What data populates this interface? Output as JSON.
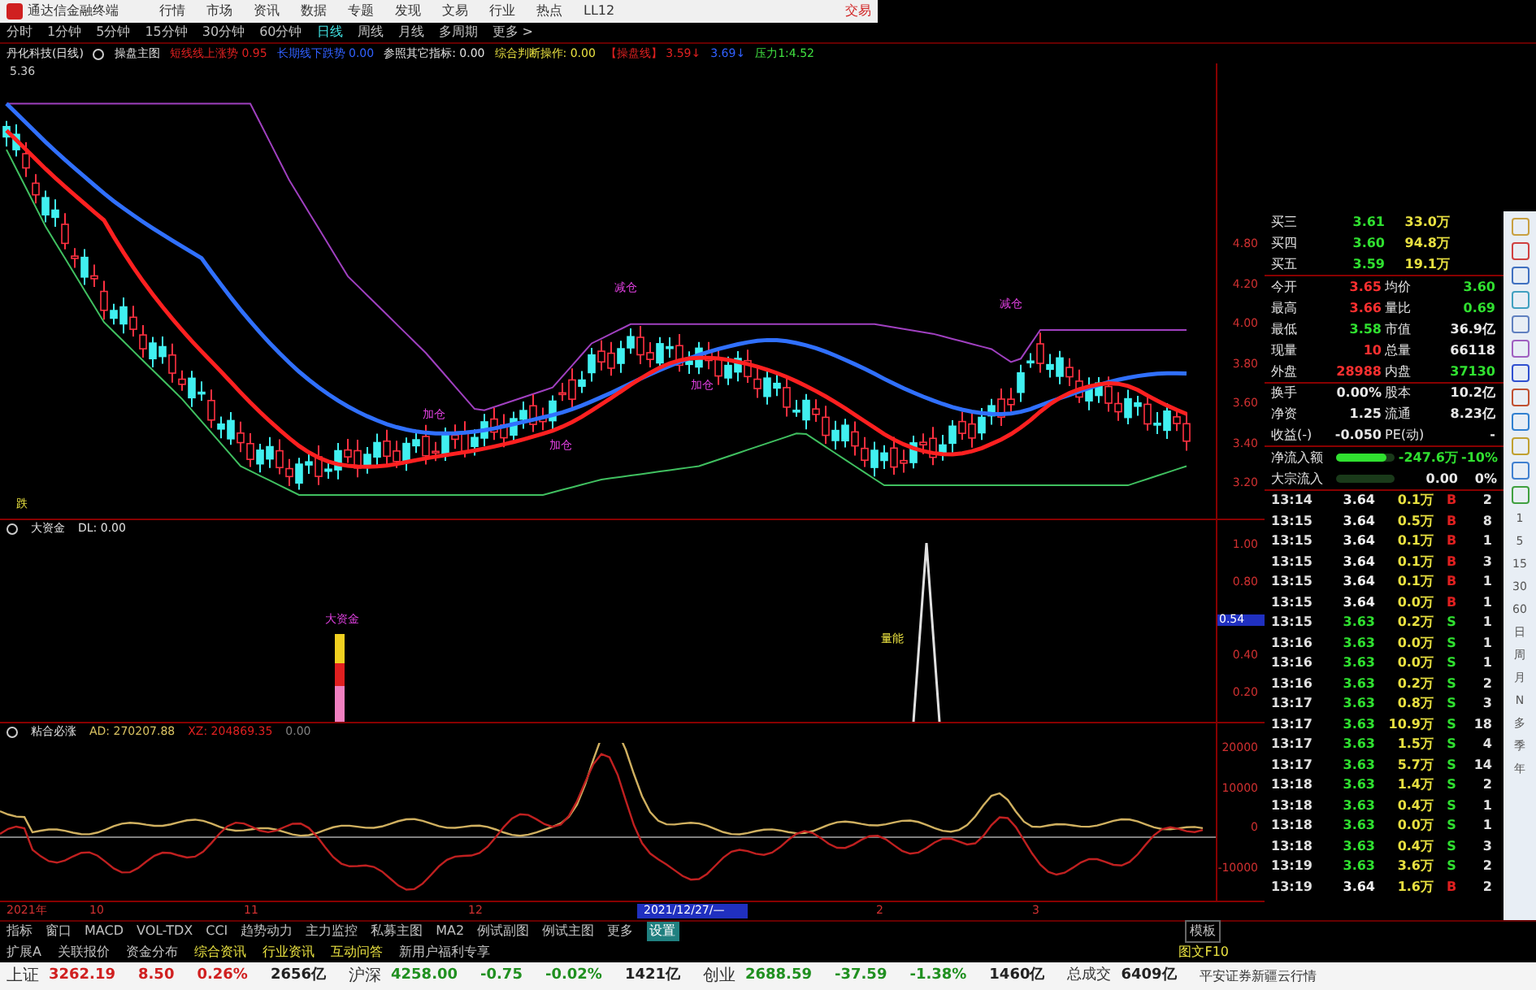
{
  "menu_bar": {
    "app_title": "通达信金融终端",
    "items": [
      "行情",
      "市场",
      "资讯",
      "数据",
      "专题",
      "发现",
      "文易",
      "行业",
      "热点",
      "LL12"
    ],
    "trade": "交易"
  },
  "periods": [
    {
      "label": "分时",
      "selected": false
    },
    {
      "label": "1分钟",
      "selected": false
    },
    {
      "label": "5分钟",
      "selected": false
    },
    {
      "label": "15分钟",
      "selected": false
    },
    {
      "label": "30分钟",
      "selected": false
    },
    {
      "label": "60分钟",
      "selected": false
    },
    {
      "label": "日线",
      "selected": true
    },
    {
      "label": "周线",
      "selected": false
    },
    {
      "label": "月线",
      "selected": false
    },
    {
      "label": "多周期",
      "selected": false
    },
    {
      "label": "更多 >",
      "selected": false
    }
  ],
  "main_chart": {
    "header": [
      {
        "text": "丹化科技(日线)",
        "color": "#e0e0e0"
      },
      {
        "text": "操盘主图",
        "color": "#e0e0e0"
      },
      {
        "text": "短线线上涨势 0.95",
        "color": "#e02020"
      },
      {
        "text": "长期线下跌势 0.00",
        "color": "#3060ff"
      },
      {
        "text": "参照其它指标: 0.00",
        "color": "#e0e0e0"
      },
      {
        "text": "综合判断操作: 0.00",
        "color": "#e8e040"
      },
      {
        "text": "【操盘线】 3.59↓",
        "color": "#e02020"
      },
      {
        "text": "3.69↓",
        "color": "#3060ff"
      },
      {
        "text": "压力1:4.52",
        "color": "#40e040"
      }
    ],
    "top_price": "5.36",
    "annotations": [
      {
        "text": "减仓",
        "color": "#e040e0"
      },
      {
        "text": "减仓",
        "color": "#e040e0"
      },
      {
        "text": "加仓",
        "color": "#e040e0"
      },
      {
        "text": "加仓",
        "color": "#e040e0"
      },
      {
        "text": "加仓",
        "color": "#e040e0"
      },
      {
        "text": "跌",
        "color": "#e8e040"
      }
    ],
    "axis": [
      "4.80",
      "4.20",
      "4.00",
      "3.80",
      "3.60",
      "3.40",
      "3.20"
    ]
  },
  "fund_chart": {
    "name": "大资金",
    "value": "DL: 0.00",
    "labels": [
      {
        "text": "大资金",
        "color": "#e040e0"
      },
      {
        "text": "量能",
        "color": "#e8e040"
      }
    ],
    "axis": [
      {
        "text": "1.00",
        "kind": "tick"
      },
      {
        "text": "0.80",
        "kind": "tick"
      },
      {
        "text": "0.54",
        "kind": "cursor"
      },
      {
        "text": "0.40",
        "kind": "tick"
      },
      {
        "text": "0.20",
        "kind": "tick"
      }
    ]
  },
  "bond_chart": {
    "name": "粘合必涨",
    "values": [
      {
        "text": "AD: 270207.88",
        "color": "#d8c060"
      },
      {
        "text": "XZ: 204869.35",
        "color": "#e02020"
      },
      {
        "text": "0.00",
        "color": "#808080"
      }
    ],
    "axis": [
      "20000",
      "10000",
      "0",
      "-10000"
    ]
  },
  "date_axis": [
    "2021年",
    "10",
    "11",
    "12",
    "2021/12/27/—",
    "2",
    "3"
  ],
  "quote": {
    "orders": [
      {
        "label": "买三",
        "price": "3.61",
        "volume": "33.0万"
      },
      {
        "label": "买四",
        "price": "3.60",
        "volume": "94.8万"
      },
      {
        "label": "买五",
        "price": "3.59",
        "volume": "19.1万"
      }
    ],
    "stats": [
      {
        "cells": [
          {
            "label": "今开",
            "value": "3.65",
            "color": "#ff3030"
          },
          {
            "label": "均价",
            "value": "3.60",
            "color": "#30e030"
          }
        ]
      },
      {
        "cells": [
          {
            "label": "最高",
            "value": "3.66",
            "color": "#ff3030"
          },
          {
            "label": "量比",
            "value": "0.69",
            "color": "#30e030"
          }
        ]
      },
      {
        "cells": [
          {
            "label": "最低",
            "value": "3.58",
            "color": "#30e030"
          },
          {
            "label": "市值",
            "value": "36.9亿",
            "color": "#e8e8e8"
          }
        ]
      },
      {
        "cells": [
          {
            "label": "现量",
            "value": "10",
            "color": "#ff3030"
          },
          {
            "label": "总量",
            "value": "66118",
            "color": "#e8e8e8"
          }
        ]
      },
      {
        "cells": [
          {
            "label": "外盘",
            "value": "28988",
            "color": "#ff3030"
          },
          {
            "label": "内盘",
            "value": "37130",
            "color": "#30e030"
          }
        ]
      },
      {
        "cells": [
          {
            "label": "换手",
            "value": "0.00%",
            "color": "#e8e8e8"
          },
          {
            "label": "股本",
            "value": "10.2亿",
            "color": "#e8e8e8"
          }
        ]
      },
      {
        "cells": [
          {
            "label": "净资",
            "value": "1.25",
            "color": "#e8e8e8"
          },
          {
            "label": "流通",
            "value": "8.23亿",
            "color": "#e8e8e8"
          }
        ]
      },
      {
        "cells": [
          {
            "label": "收益(-)",
            "value": "-0.050",
            "color": "#e8e8e8"
          },
          {
            "label": "PE(动)",
            "value": "-",
            "color": "#e8e8e8"
          }
        ]
      }
    ],
    "flows": [
      {
        "label": "净流入额",
        "level": 0.85,
        "amount": "-247.6万",
        "percent": "-10%",
        "color": "#30e030"
      },
      {
        "label": "大宗流入",
        "level": 0,
        "amount": "0.00",
        "percent": "0%",
        "color": "#e8e8e8"
      }
    ],
    "ticks": [
      {
        "time": "13:14",
        "price": "3.64",
        "volume": "0.1万",
        "side": "B",
        "count": "2"
      },
      {
        "time": "13:15",
        "price": "3.64",
        "volume": "0.5万",
        "side": "B",
        "count": "8"
      },
      {
        "time": "13:15",
        "price": "3.64",
        "volume": "0.1万",
        "side": "B",
        "count": "1"
      },
      {
        "time": "13:15",
        "price": "3.64",
        "volume": "0.1万",
        "side": "B",
        "count": "3"
      },
      {
        "time": "13:15",
        "price": "3.64",
        "volume": "0.1万",
        "side": "B",
        "count": "1"
      },
      {
        "time": "13:15",
        "price": "3.64",
        "volume": "0.0万",
        "side": "B",
        "count": "1"
      },
      {
        "time": "13:15",
        "price": "3.63",
        "volume": "0.2万",
        "side": "S",
        "count": "1"
      },
      {
        "time": "13:16",
        "price": "3.63",
        "volume": "0.0万",
        "side": "S",
        "count": "1"
      },
      {
        "time": "13:16",
        "price": "3.63",
        "volume": "0.0万",
        "side": "S",
        "count": "1"
      },
      {
        "time": "13:16",
        "price": "3.63",
        "volume": "0.2万",
        "side": "S",
        "count": "2"
      },
      {
        "time": "13:17",
        "price": "3.63",
        "volume": "0.8万",
        "side": "S",
        "count": "3"
      },
      {
        "time": "13:17",
        "price": "3.63",
        "volume": "10.9万",
        "side": "S",
        "count": "18"
      },
      {
        "time": "13:17",
        "price": "3.63",
        "volume": "1.5万",
        "side": "S",
        "count": "4"
      },
      {
        "time": "13:17",
        "price": "3.63",
        "volume": "5.7万",
        "side": "S",
        "count": "14"
      },
      {
        "time": "13:18",
        "price": "3.63",
        "volume": "1.4万",
        "side": "S",
        "count": "2"
      },
      {
        "time": "13:18",
        "price": "3.63",
        "volume": "0.4万",
        "side": "S",
        "count": "1"
      },
      {
        "time": "13:18",
        "price": "3.63",
        "volume": "0.0万",
        "side": "S",
        "count": "1"
      },
      {
        "time": "13:18",
        "price": "3.63",
        "volume": "0.4万",
        "side": "S",
        "count": "3"
      },
      {
        "time": "13:19",
        "price": "3.63",
        "volume": "3.6万",
        "side": "S",
        "count": "2"
      },
      {
        "time": "13:19",
        "price": "3.64",
        "volume": "1.6万",
        "side": "B",
        "count": "2"
      }
    ]
  },
  "side_periods": [
    "1",
    "5",
    "15",
    "30",
    "60",
    "日",
    "周",
    "月",
    "N",
    "多",
    "季",
    "年"
  ],
  "corner": {
    "template": "模板",
    "f10": "图文F10"
  },
  "indicator_tabs": [
    {
      "label": "指标",
      "selected": false
    },
    {
      "label": "窗口",
      "selected": false
    },
    {
      "label": "MACD",
      "selected": false
    },
    {
      "label": "VOL-TDX",
      "selected": false
    },
    {
      "label": "CCI",
      "selected": false
    },
    {
      "label": "趋势动力",
      "selected": false
    },
    {
      "label": "主力监控",
      "selected": false
    },
    {
      "label": "私募主图",
      "selected": false
    },
    {
      "label": "MA2",
      "selected": false
    },
    {
      "label": "例试副图",
      "selected": false
    },
    {
      "label": "例试主图",
      "selected": false
    },
    {
      "label": "更多",
      "selected": false
    },
    {
      "label": "设置",
      "selected": true
    }
  ],
  "info_tabs": [
    {
      "label": "扩展A",
      "color": "#c0c0c0"
    },
    {
      "label": "关联报价",
      "color": "#c0c0c0"
    },
    {
      "label": "资金分布",
      "color": "#c0c0c0"
    },
    {
      "label": "综合资讯",
      "color": "#e8e040"
    },
    {
      "label": "行业资讯",
      "color": "#e8e040"
    },
    {
      "label": "互动问答",
      "color": "#e8e040"
    },
    {
      "label": "新用户福利专享",
      "color": "#c0c0c0"
    }
  ],
  "status_bar": [
    {
      "name": "上证",
      "value": "3262.19",
      "change": "8.50",
      "percent": "0.26%",
      "amount": "2656亿",
      "color": "#d02020"
    },
    {
      "name": "沪深",
      "value": "4258.00",
      "change": "-0.75",
      "percent": "-0.02%",
      "amount": "1421亿",
      "color": "#209020"
    },
    {
      "name": "创业",
      "value": "2688.59",
      "change": "-37.59",
      "percent": "-1.38%",
      "amount": "1460亿",
      "color": "#209020"
    }
  ],
  "total": {
    "label": "总成交",
    "amount": "6409亿"
  },
  "broker": "平安证券新疆云行情"
}
